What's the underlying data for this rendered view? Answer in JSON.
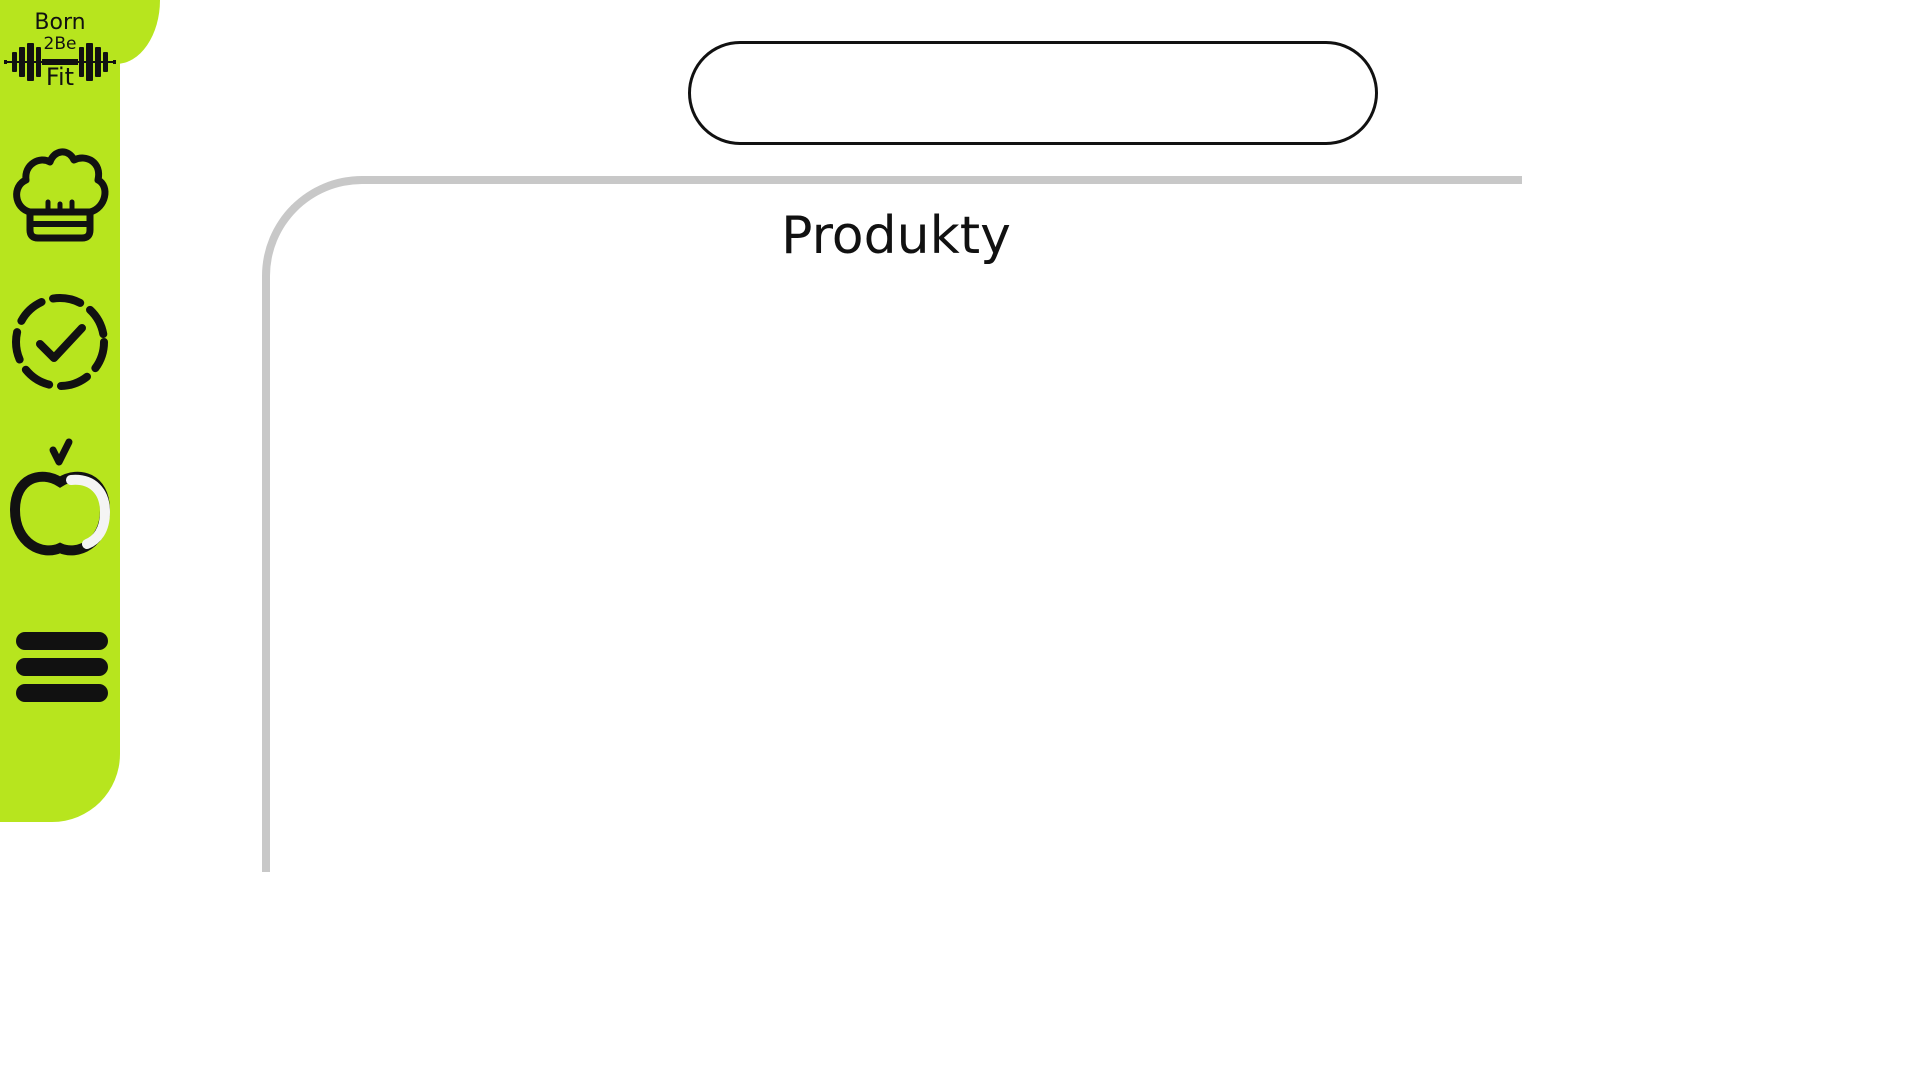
{
  "app": {
    "logo": {
      "line1": "Born",
      "line2": "2Be",
      "line3": "Fit"
    },
    "accent_color": "#b7e51e"
  },
  "sidebar": {
    "items": [
      {
        "icon": "chef-hat-icon"
      },
      {
        "icon": "dashed-check-circle-icon"
      },
      {
        "icon": "apple-icon"
      },
      {
        "icon": "hamburger-menu-icon"
      }
    ]
  },
  "search": {
    "value": "",
    "placeholder": ""
  },
  "products": {
    "title": "Produkty"
  }
}
